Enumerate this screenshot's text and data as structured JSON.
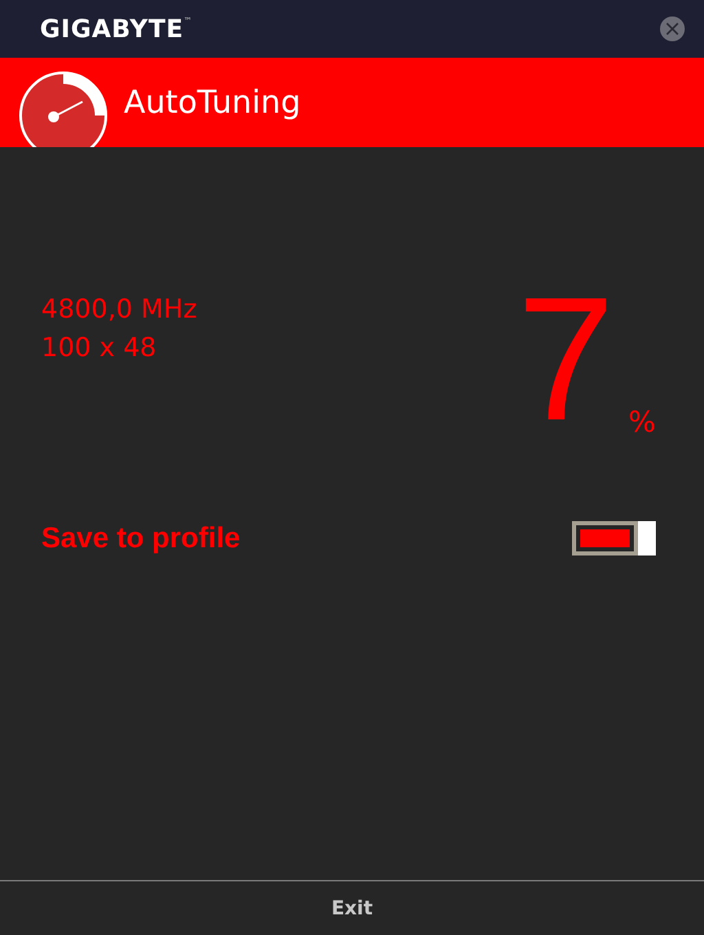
{
  "window": {
    "title": "GIGABYTE",
    "trademark": "™"
  },
  "header": {
    "title": "AutoTuning"
  },
  "readings": {
    "frequency": "4800,0 MHz",
    "ratio": "100 x 48",
    "progress": "7",
    "unit": "%"
  },
  "save_to_profile": {
    "label": "Save to profile",
    "on": true
  },
  "footer": {
    "button": "Exit"
  }
}
